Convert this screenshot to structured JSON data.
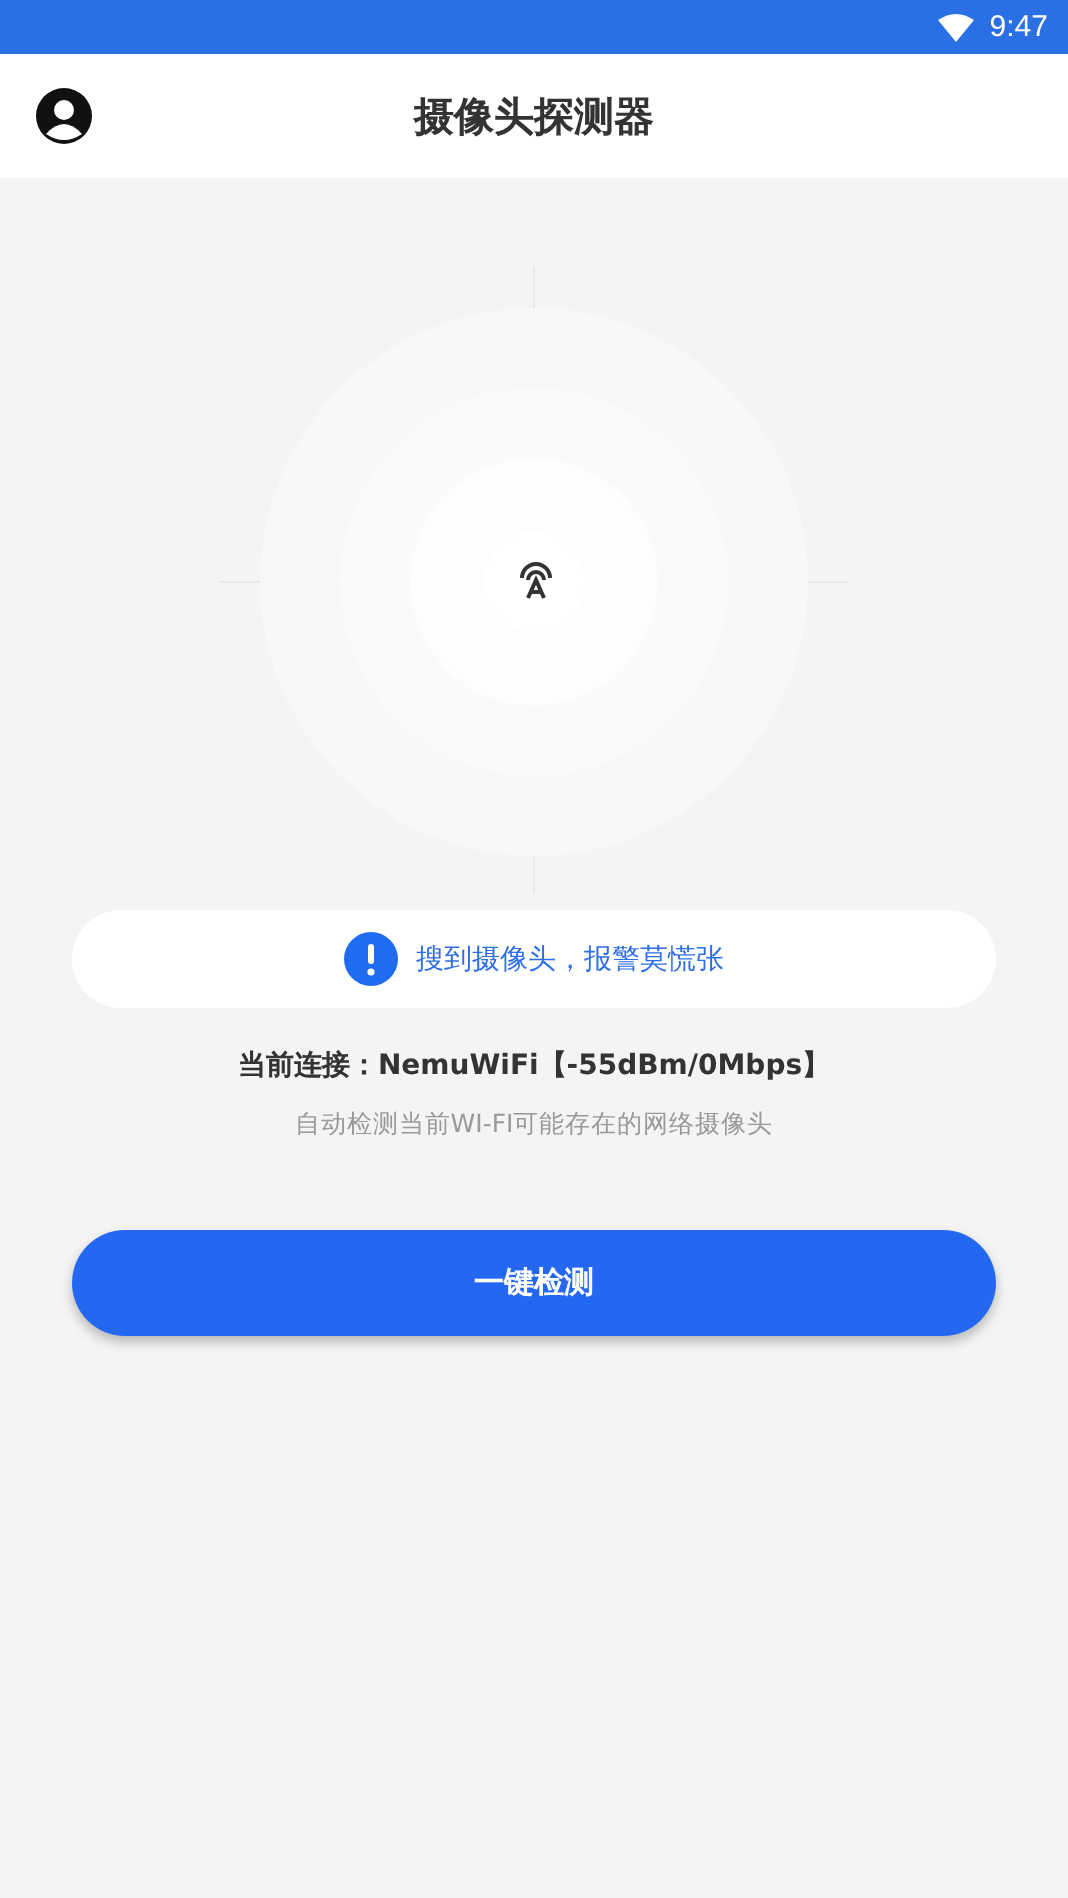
{
  "status_bar": {
    "time": "9:47"
  },
  "header": {
    "title": "摄像头探测器"
  },
  "alert": {
    "text": "搜到摄像头，报警莫慌张"
  },
  "connection": {
    "text": "当前连接：NemuWiFi【-55dBm/0Mbps】"
  },
  "hint": {
    "text": "自动检测当前WI-FI可能存在的网络摄像头"
  },
  "scan_button": {
    "label": "一键检测"
  }
}
